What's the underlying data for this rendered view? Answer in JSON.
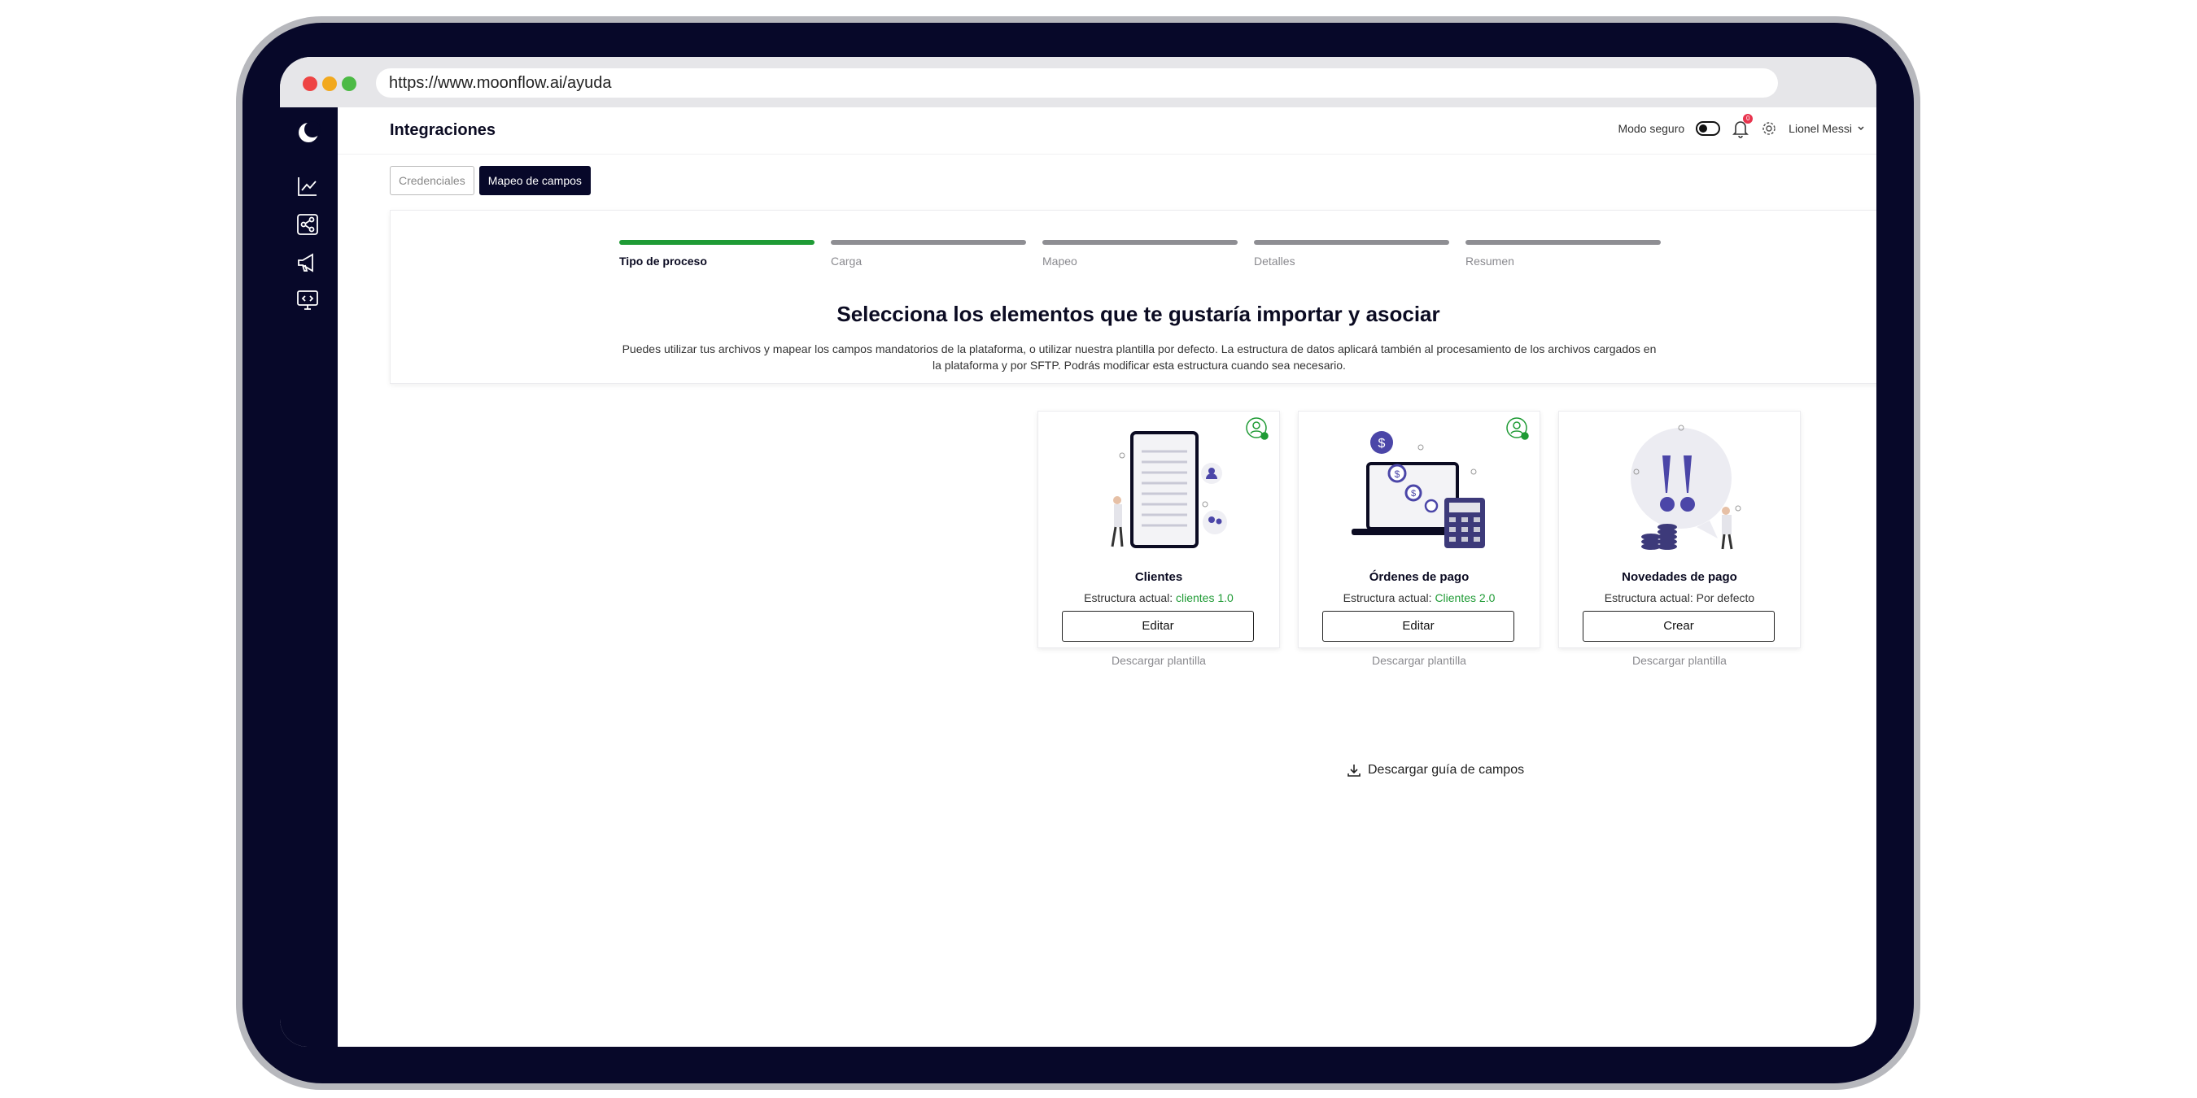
{
  "browser": {
    "url": "https://www.moonflow.ai/ayuda"
  },
  "header": {
    "title": "Integraciones",
    "safe_mode_label": "Modo seguro",
    "notification_count": "0",
    "user_name": "Lionel Messi"
  },
  "tabs": [
    {
      "label": "Credenciales",
      "active": false
    },
    {
      "label": "Mapeo de campos",
      "active": true
    }
  ],
  "steps": [
    {
      "label": "Tipo de proceso",
      "done": true
    },
    {
      "label": "Carga",
      "done": false
    },
    {
      "label": "Mapeo",
      "done": false
    },
    {
      "label": "Detalles",
      "done": false
    },
    {
      "label": "Resumen",
      "done": false
    }
  ],
  "intro": {
    "headline": "Selecciona los elementos que te gustaría importar y asociar",
    "description": "Puedes utilizar tus archivos y mapear los campos mandatorios de la plataforma, o utilizar nuestra plantilla por defecto. La estructura de datos aplicará también al procesamiento de los archivos cargados en la plataforma y por SFTP. Podrás modificar esta estructura cuando sea necesario."
  },
  "cards": [
    {
      "title": "Clientes",
      "structure_label": "Estructura actual:",
      "structure_value": "clientes 1.0",
      "button": "Editar",
      "link": "Descargar plantilla"
    },
    {
      "title": "Órdenes de pago",
      "structure_label": "Estructura actual:",
      "structure_value": "Clientes 2.0",
      "button": "Editar",
      "link": "Descargar plantilla"
    },
    {
      "title": "Novedades de pago",
      "structure_label": "Estructura actual:",
      "structure_value": "Por defecto",
      "button": "Crear",
      "link": "Descargar plantilla"
    }
  ],
  "guide_link": "Descargar guía de campos",
  "colors": {
    "accent": "#070829",
    "success": "#1f9b35",
    "badge": "#e8344e"
  }
}
